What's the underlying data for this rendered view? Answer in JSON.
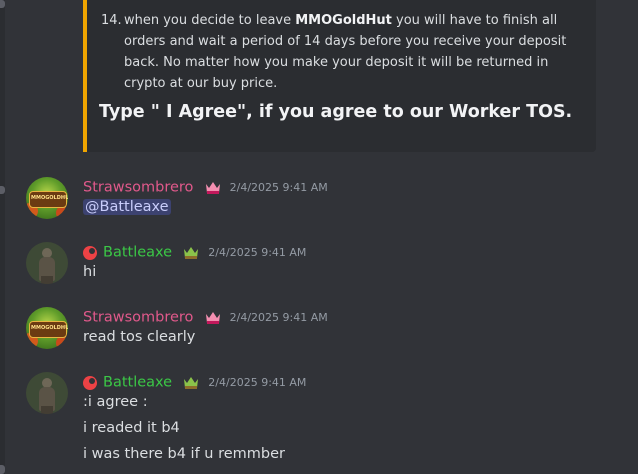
{
  "embed": {
    "tos_item": {
      "number": "14.",
      "text_pre": "when you decide to leave ",
      "text_bold": "MMOGoldHut",
      "text_post": " you will have to finish all orders and wait a period of 14 days before you receive your deposit back. No matter how you make your deposit it will be returned in crypto at our buy price."
    },
    "cta": "Type \" I Agree\", if you agree to our Worker TOS.",
    "accent_color": "#f0a500"
  },
  "messages": [
    {
      "author": "Strawsombrero",
      "author_color": "#e0598b",
      "avatar_text": "MMOGOLDHUT",
      "badge_icon": "crown-icon",
      "timestamp": "2/4/2025 9:41 AM",
      "lines": [
        "@Battleaxe"
      ]
    },
    {
      "author": "Battleaxe",
      "author_color": "#3bc746",
      "status_icon": "role-icon",
      "badge_icon": "crown-icon",
      "timestamp": "2/4/2025 9:41 AM",
      "lines": [
        "hi"
      ]
    },
    {
      "author": "Strawsombrero",
      "author_color": "#e0598b",
      "avatar_text": "MMOGOLDHUT",
      "badge_icon": "crown-icon",
      "timestamp": "2/4/2025 9:41 AM",
      "lines": [
        "read tos clearly"
      ]
    },
    {
      "author": "Battleaxe",
      "author_color": "#3bc746",
      "status_icon": "role-icon",
      "badge_icon": "crown-icon",
      "timestamp": "2/4/2025 9:41 AM",
      "lines": [
        ":i agree :",
        "i readed it b4",
        "i was there b4 if u remmber"
      ]
    }
  ]
}
